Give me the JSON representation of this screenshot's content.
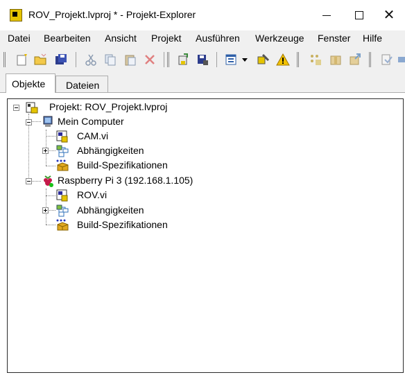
{
  "window": {
    "title": "ROV_Projekt.lvproj * - Projekt-Explorer",
    "minimize": "minimize",
    "maximize": "maximize",
    "close": "✕"
  },
  "menu": [
    "Datei",
    "Bearbeiten",
    "Ansicht",
    "Projekt",
    "Ausführen",
    "Werkzeuge",
    "Fenster",
    "Hilfe"
  ],
  "toolbar": {
    "icons": [
      "new-icon",
      "open-icon",
      "save-all-icon",
      "cut-icon",
      "copy-icon",
      "paste-icon",
      "delete-icon",
      "build-icon",
      "save-build-icon",
      "view-icon",
      "dropdown-icon",
      "deploy-icon",
      "warning-icon",
      "group-icon",
      "package-icon",
      "export-icon",
      "run-icon"
    ]
  },
  "tabs": {
    "objects": "Objekte",
    "files": "Dateien",
    "active": "Objekte"
  },
  "tree": {
    "project": "Projekt: ROV_Projekt.lvproj",
    "computer": {
      "label": "Mein Computer",
      "children": [
        "CAM.vi",
        "Abhängigkeiten",
        "Build-Spezifikationen"
      ]
    },
    "target": {
      "label": "Raspberry Pi 3 (192.168.1.105)",
      "children": [
        "ROV.vi",
        "Abhängigkeiten",
        "Build-Spezifikationen"
      ]
    }
  },
  "colors": {
    "vi_icon": "#e5c400",
    "raspberry": "#c51a4a",
    "connected": "#18c018",
    "folder": "#d8a000"
  }
}
